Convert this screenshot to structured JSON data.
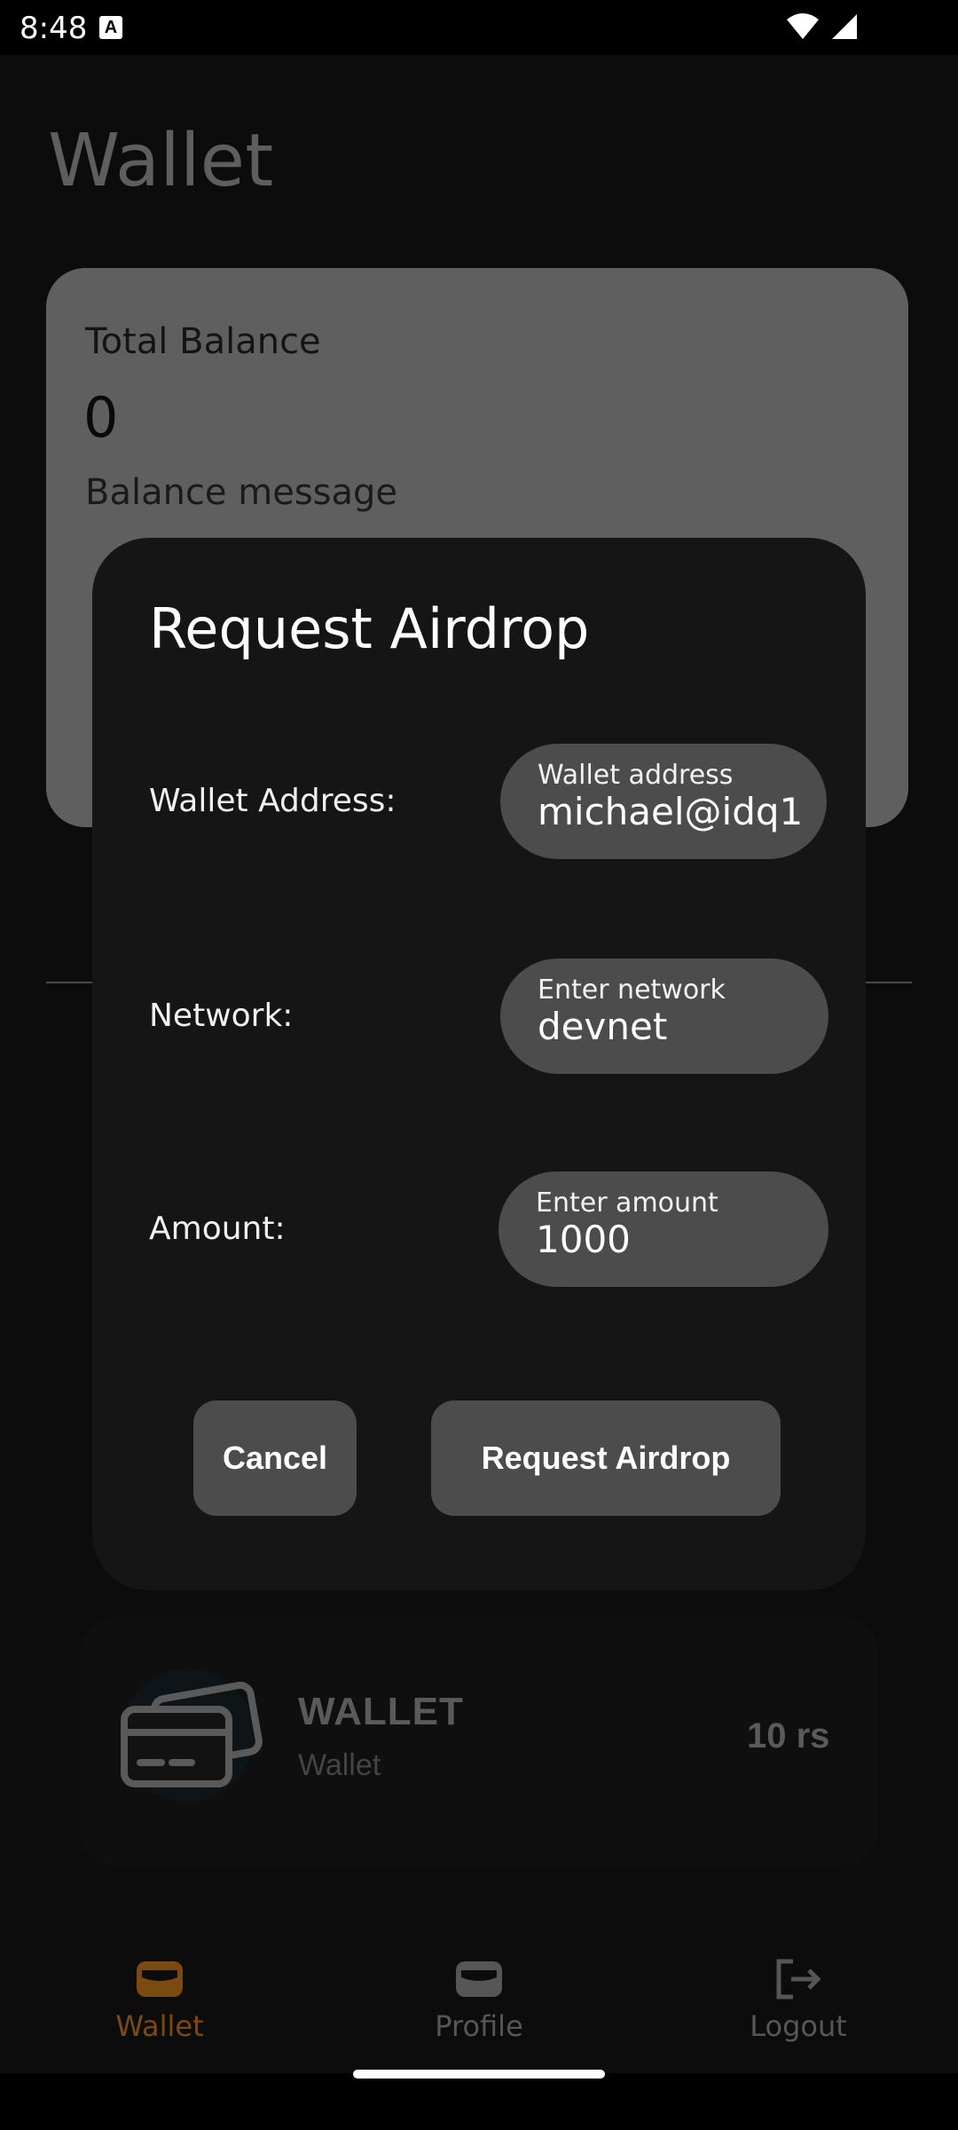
{
  "status_bar": {
    "time": "8:48",
    "notification_glyph": "A"
  },
  "page": {
    "title": "Wallet"
  },
  "balance_card": {
    "label": "Total Balance",
    "value": "0",
    "message": "Balance message"
  },
  "wallet_item": {
    "name": "WALLET",
    "subtitle": "Wallet",
    "amount": "10 rs",
    "icon": "card-icon"
  },
  "bottom_nav": {
    "items": [
      {
        "label": "Wallet",
        "icon": "wallet-icon",
        "active": true
      },
      {
        "label": "Profile",
        "icon": "wallet-icon",
        "active": false
      },
      {
        "label": "Logout",
        "icon": "logout-icon",
        "active": false
      }
    ],
    "active_color": "#7a4a10",
    "inactive_color": "#565656"
  },
  "dialog": {
    "title": "Request Airdrop",
    "fields": {
      "wallet_address": {
        "label": "Wallet Address:",
        "field_label": "Wallet address",
        "value": "michael@idq1"
      },
      "network": {
        "label": "Network:",
        "field_label": "Enter network",
        "value": "devnet"
      },
      "amount": {
        "label": "Amount:",
        "field_label": "Enter amount",
        "value": "1000"
      }
    },
    "buttons": {
      "cancel": "Cancel",
      "request": "Request Airdrop"
    }
  }
}
